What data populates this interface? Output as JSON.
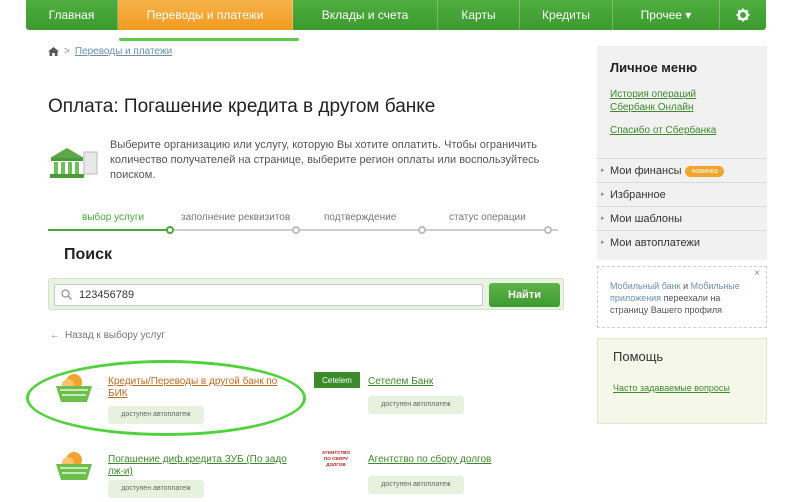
{
  "nav": {
    "items": [
      {
        "label": "Главная"
      },
      {
        "label": "Переводы и платежи"
      },
      {
        "label": "Вклады и счета"
      },
      {
        "label": "Карты"
      },
      {
        "label": "Кредиты"
      },
      {
        "label": "Прочее ▾"
      }
    ],
    "active_index": 1,
    "colors": {
      "nav": "#45a436",
      "active": "#f3a331"
    }
  },
  "breadcrumb": {
    "separator": ">",
    "item": "Переводы и платежи"
  },
  "page_title": "Оплата: Погашение кредита в другом банке",
  "intro_text": "Выберите организацию или услугу, которую Вы хотите оплатить. Чтобы ограничить количество получателей на странице, выберите регион оплаты или воспользуйтесь поиском.",
  "steps": [
    {
      "label": "выбор услуги",
      "active": true
    },
    {
      "label": "заполнение реквизитов",
      "active": false
    },
    {
      "label": "подтверждение",
      "active": false
    },
    {
      "label": "статус операции",
      "active": false
    }
  ],
  "search": {
    "title": "Поиск",
    "value": "123456789",
    "button": "Найти"
  },
  "back_link": "Назад к выбору услуг",
  "services": [
    {
      "name": "Кредиты/Переводы в другой банк по БИК",
      "badge": "доступен автоплатеж",
      "logo": "basket-icon"
    },
    {
      "name": "Сетелем Банк",
      "badge": "доступен автоплатеж",
      "logo": "cetelem-logo",
      "logo_text": "Cetelem"
    },
    {
      "name": "Погашение диф.кредита ЗУБ (По задо лж-и)",
      "badge": "доступен автоплатеж",
      "logo": "basket-icon"
    },
    {
      "name": "Агентство по сбору долгов",
      "badge": "доступен автоплатеж",
      "logo": "agency-logo",
      "logo_text": "АГЕНТСТВО ПО СБОРУ ДОЛГОВ"
    }
  ],
  "sidebar": {
    "title": "Личное меню",
    "links": [
      "История операций Сбербанк Онлайн",
      "Спасибо от Сбербанка"
    ],
    "menu": [
      {
        "label": "Мои финансы",
        "badge": "новинка"
      },
      {
        "label": "Избранное"
      },
      {
        "label": "Мои шаблоны"
      },
      {
        "label": "Мои автоплатежи"
      }
    ]
  },
  "notice": {
    "link1": "Мобильный банк",
    "mid": " и ",
    "link2": "Мобильные приложения",
    "rest": " переехали на страницу Вашего профиля",
    "close": "×"
  },
  "help": {
    "title": "Помощь",
    "link": "Часто задаваемые вопросы"
  }
}
